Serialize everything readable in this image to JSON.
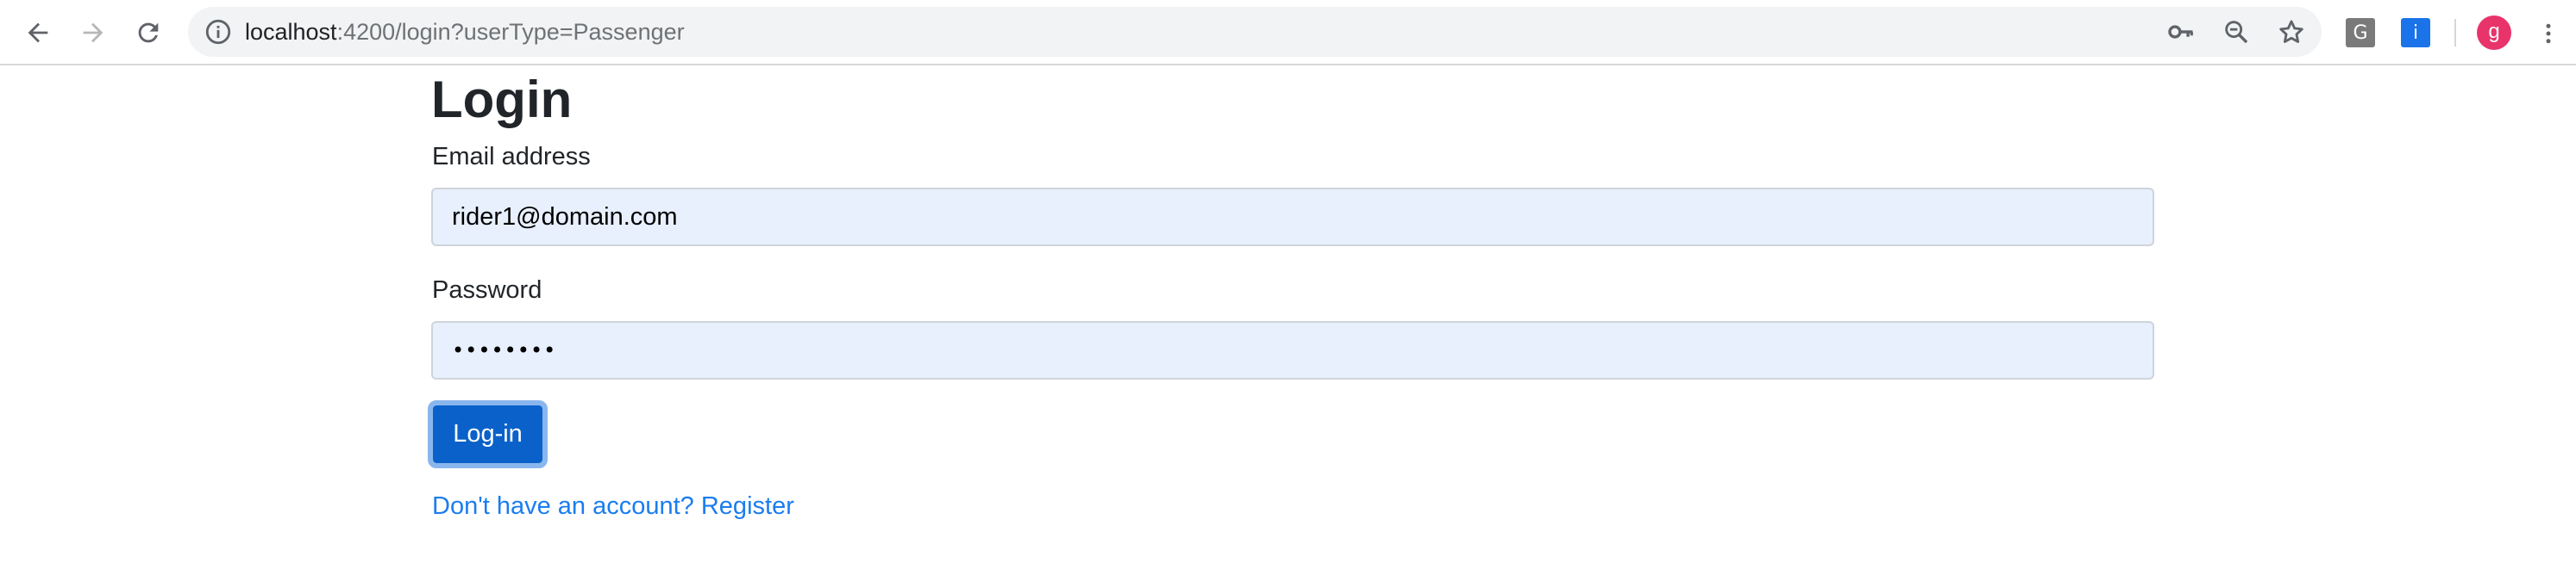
{
  "browser": {
    "url_host": "localhost",
    "url_rest": ":4200/login?userType=Passenger",
    "icons": {
      "back": "back-arrow-icon",
      "forward": "forward-arrow-icon",
      "reload": "reload-icon",
      "site_info": "info-icon",
      "password_key": "key-icon",
      "zoom": "zoom-icon",
      "bookmark": "star-icon",
      "menu": "more-vert-icon"
    },
    "extensions": [
      {
        "letter": "G",
        "color": "#7a7a7a"
      },
      {
        "letter": "i",
        "color": "#1a73e8"
      }
    ],
    "profile": {
      "initial": "g",
      "color": "#e8336b"
    }
  },
  "page": {
    "title": "Login",
    "email": {
      "label": "Email address",
      "value": "rider1@domain.com"
    },
    "password": {
      "label": "Password",
      "value": "••••••••"
    },
    "login_button": "Log-in",
    "register_link": "Don't have an account? Register"
  },
  "colors": {
    "primary_button": "#0a61c9",
    "link": "#1a7df0",
    "autofill_bg": "#e8f0fe",
    "text": "#212529"
  }
}
